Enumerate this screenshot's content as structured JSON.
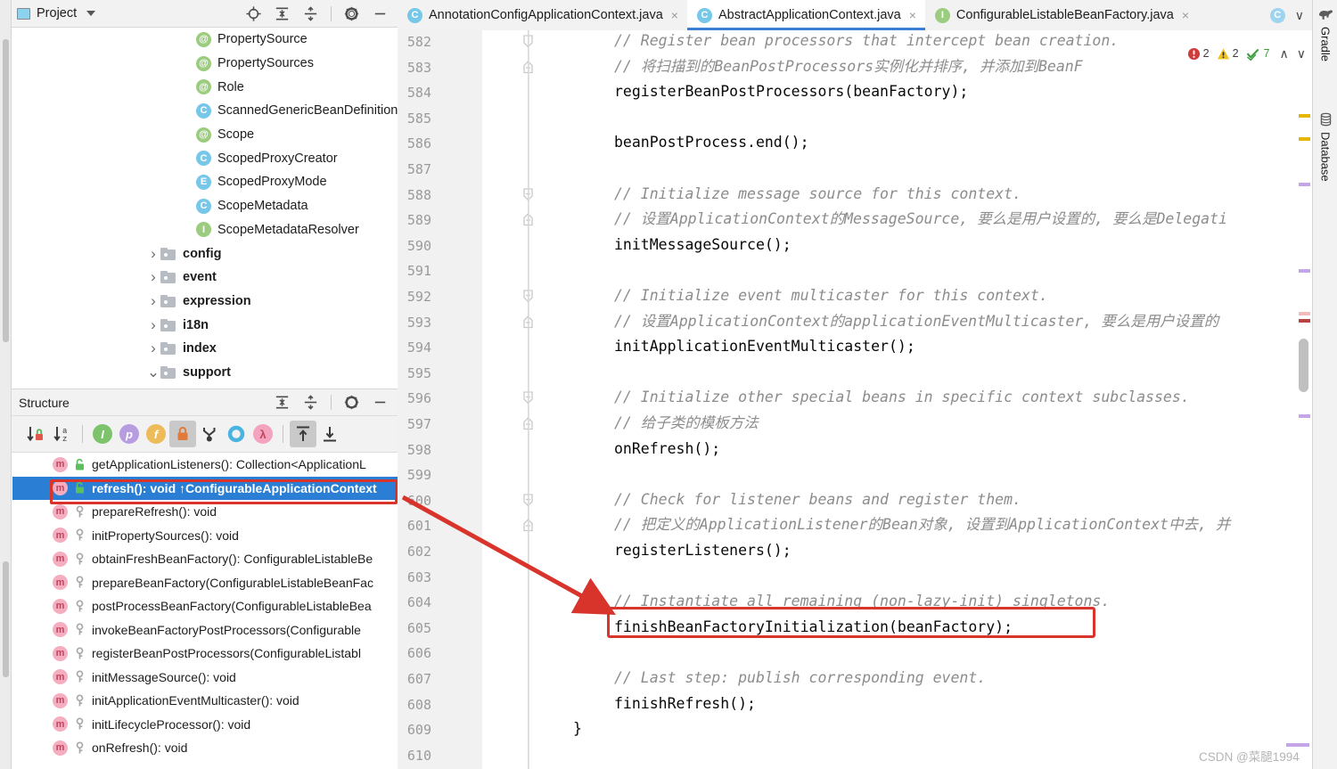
{
  "project_panel": {
    "title": "Project",
    "icon": "project-icon",
    "toolbar": [
      {
        "name": "locate-icon",
        "label": "Select Opened File"
      },
      {
        "name": "expand-all-icon",
        "label": "Expand All"
      },
      {
        "name": "collapse-all-icon",
        "label": "Collapse All"
      },
      {
        "name": "gear-icon",
        "label": "Options"
      },
      {
        "name": "minimize-icon",
        "label": "Hide"
      }
    ],
    "tree": [
      {
        "label": "PropertySource",
        "kind": "annotation",
        "badge": "@",
        "indent": 2,
        "arrow": ""
      },
      {
        "label": "PropertySources",
        "kind": "annotation",
        "badge": "@",
        "indent": 2,
        "arrow": ""
      },
      {
        "label": "Role",
        "kind": "annotation",
        "badge": "@",
        "indent": 2,
        "arrow": ""
      },
      {
        "label": "ScannedGenericBeanDefinition",
        "kind": "class",
        "badge": "C",
        "indent": 2,
        "arrow": ""
      },
      {
        "label": "Scope",
        "kind": "annotation",
        "badge": "@",
        "indent": 2,
        "arrow": ""
      },
      {
        "label": "ScopedProxyCreator",
        "kind": "class",
        "badge": "C",
        "indent": 2,
        "arrow": ""
      },
      {
        "label": "ScopedProxyMode",
        "kind": "enum",
        "badge": "E",
        "indent": 2,
        "arrow": ""
      },
      {
        "label": "ScopeMetadata",
        "kind": "class",
        "badge": "C",
        "indent": 2,
        "arrow": ""
      },
      {
        "label": "ScopeMetadataResolver",
        "kind": "interface",
        "badge": "I",
        "indent": 2,
        "arrow": ""
      },
      {
        "label": "config",
        "kind": "folder",
        "badge": "",
        "indent": 1,
        "arrow": "collapsed"
      },
      {
        "label": "event",
        "kind": "folder",
        "badge": "",
        "indent": 1,
        "arrow": "collapsed"
      },
      {
        "label": "expression",
        "kind": "folder",
        "badge": "",
        "indent": 1,
        "arrow": "collapsed"
      },
      {
        "label": "i18n",
        "kind": "folder",
        "badge": "",
        "indent": 1,
        "arrow": "collapsed"
      },
      {
        "label": "index",
        "kind": "folder",
        "badge": "",
        "indent": 1,
        "arrow": "collapsed"
      },
      {
        "label": "support",
        "kind": "folder",
        "badge": "",
        "indent": 1,
        "arrow": "expanded"
      }
    ]
  },
  "structure_panel": {
    "title": "Structure",
    "header_icons": [
      {
        "name": "expand-all-icon"
      },
      {
        "name": "collapse-all-icon"
      },
      {
        "name": "gear-icon"
      },
      {
        "name": "minimize-icon"
      }
    ],
    "toolbar": [
      {
        "name": "sort-by-visibility-icon",
        "active": false
      },
      {
        "name": "sort-alphabetically-icon",
        "active": false
      },
      {
        "name": "show-inherited-icon",
        "active": false,
        "glyph": "I",
        "color": "#7dc36b"
      },
      {
        "name": "show-properties-icon",
        "active": false,
        "glyph": "p",
        "color": "#b79cdf"
      },
      {
        "name": "show-fields-icon",
        "active": false,
        "glyph": "f",
        "color": "#eebb5a"
      },
      {
        "name": "show-non-public-icon",
        "active": true,
        "glyph": "lock",
        "color": "#e07b3c"
      },
      {
        "name": "show-anonymous-classes-icon",
        "active": false
      },
      {
        "name": "show-properties-group-icon",
        "active": false
      },
      {
        "name": "show-lambdas-icon",
        "active": false,
        "glyph": "λ",
        "color": "#f3a3bd"
      },
      {
        "name": "expand-all-icon",
        "active": true
      },
      {
        "name": "collapse-all-icon",
        "active": false
      }
    ],
    "members": [
      {
        "label": "getApplicationListeners(): Collection<ApplicationL",
        "visibility": "public",
        "selected": false
      },
      {
        "label": "refresh(): void ↑ConfigurableApplicationContext",
        "visibility": "public",
        "selected": true
      },
      {
        "label": "prepareRefresh(): void",
        "visibility": "protected",
        "selected": false
      },
      {
        "label": "initPropertySources(): void",
        "visibility": "protected",
        "selected": false
      },
      {
        "label": "obtainFreshBeanFactory(): ConfigurableListableBe",
        "visibility": "protected",
        "selected": false
      },
      {
        "label": "prepareBeanFactory(ConfigurableListableBeanFac",
        "visibility": "protected",
        "selected": false
      },
      {
        "label": "postProcessBeanFactory(ConfigurableListableBea",
        "visibility": "protected",
        "selected": false
      },
      {
        "label": "invokeBeanFactoryPostProcessors(Configurable",
        "visibility": "protected",
        "selected": false
      },
      {
        "label": "registerBeanPostProcessors(ConfigurableListabl",
        "visibility": "protected",
        "selected": false
      },
      {
        "label": "initMessageSource(): void",
        "visibility": "protected",
        "selected": false
      },
      {
        "label": "initApplicationEventMulticaster(): void",
        "visibility": "protected",
        "selected": false
      },
      {
        "label": "initLifecycleProcessor(): void",
        "visibility": "protected",
        "selected": false
      },
      {
        "label": "onRefresh(): void",
        "visibility": "protected",
        "selected": false
      }
    ]
  },
  "editor": {
    "tabs": [
      {
        "label": "AnnotationConfigApplicationContext.java",
        "badge": "C",
        "badge_color": "#76c7e8",
        "active": false,
        "closable": true
      },
      {
        "label": "AbstractApplicationContext.java",
        "badge": "C",
        "badge_color": "#76c7e8",
        "active": true,
        "closable": true
      },
      {
        "label": "ConfigurableListableBeanFactory.java",
        "badge": "I",
        "badge_color": "#9ccc7f",
        "active": false,
        "closable": true
      }
    ],
    "overflow": {
      "badge": "C",
      "chevron": "chevron-down-icon"
    },
    "first_line_number": 582,
    "lines": [
      {
        "num": 582,
        "text": "// Register bean processors that intercept bean creation.",
        "style": "comment",
        "fold": "end"
      },
      {
        "num": 583,
        "text": "// 将扫描到的BeanPostProcessors实例化并排序, 并添加到BeanF",
        "style": "comment",
        "fold": "end2"
      },
      {
        "num": 584,
        "text": "registerBeanPostProcessors(beanFactory);",
        "style": "code",
        "fold": ""
      },
      {
        "num": 585,
        "text": "",
        "style": "code",
        "fold": ""
      },
      {
        "num": 586,
        "text": "beanPostProcess.end();",
        "style": "code",
        "fold": ""
      },
      {
        "num": 587,
        "text": "",
        "style": "code",
        "fold": ""
      },
      {
        "num": 588,
        "text": "// Initialize message source for this context.",
        "style": "comment",
        "fold": "start"
      },
      {
        "num": 589,
        "text": "// 设置ApplicationContext的MessageSource, 要么是用户设置的, 要么是Delegati",
        "style": "comment",
        "fold": "end2"
      },
      {
        "num": 590,
        "text": "initMessageSource();",
        "style": "code",
        "fold": ""
      },
      {
        "num": 591,
        "text": "",
        "style": "code",
        "fold": ""
      },
      {
        "num": 592,
        "text": "// Initialize event multicaster for this context.",
        "style": "comment",
        "fold": "start"
      },
      {
        "num": 593,
        "text": "// 设置ApplicationContext的applicationEventMulticaster, 要么是用户设置的",
        "style": "comment",
        "fold": "end2"
      },
      {
        "num": 594,
        "text": "initApplicationEventMulticaster();",
        "style": "code",
        "fold": ""
      },
      {
        "num": 595,
        "text": "",
        "style": "code",
        "fold": ""
      },
      {
        "num": 596,
        "text": "// Initialize other special beans in specific context subclasses.",
        "style": "comment",
        "fold": "start"
      },
      {
        "num": 597,
        "text": "// 给子类的模板方法",
        "style": "comment",
        "fold": "end2"
      },
      {
        "num": 598,
        "text": "onRefresh();",
        "style": "code",
        "fold": ""
      },
      {
        "num": 599,
        "text": "",
        "style": "code",
        "fold": ""
      },
      {
        "num": 600,
        "text": "// Check for listener beans and register them.",
        "style": "comment",
        "fold": "start"
      },
      {
        "num": 601,
        "text": "// 把定义的ApplicationListener的Bean对象, 设置到ApplicationContext中去, 并",
        "style": "comment",
        "fold": "end2"
      },
      {
        "num": 602,
        "text": "registerListeners();",
        "style": "code",
        "fold": ""
      },
      {
        "num": 603,
        "text": "",
        "style": "code",
        "fold": ""
      },
      {
        "num": 604,
        "text": "// Instantiate all remaining (non-lazy-init) singletons.",
        "style": "comment",
        "fold": ""
      },
      {
        "num": 605,
        "text": "finishBeanFactoryInitialization(beanFactory);",
        "style": "code",
        "fold": ""
      },
      {
        "num": 606,
        "text": "",
        "style": "code",
        "fold": ""
      },
      {
        "num": 607,
        "text": "// Last step: publish corresponding event.",
        "style": "comment",
        "fold": ""
      },
      {
        "num": 608,
        "text": "finishRefresh();",
        "style": "code",
        "fold": ""
      },
      {
        "num": 609,
        "text": "}",
        "style": "brace",
        "fold": ""
      },
      {
        "num": 610,
        "text": "",
        "style": "code",
        "fold": ""
      }
    ],
    "highlighted_line": "finishBeanFactoryInitialization(beanFactory);",
    "inspections": {
      "errors": "2",
      "warnings": "2",
      "ok_count": "7",
      "error_icon": "error-icon",
      "warning_icon": "warning-icon",
      "ok_icon": "inspection-ok-icon",
      "prev_icon": "chevron-up-icon",
      "next_icon": "chevron-down-icon"
    }
  },
  "right_rail": {
    "tabs": [
      {
        "label": "Gradle",
        "icon": "gradle-elephant-icon"
      },
      {
        "label": "Database",
        "icon": "database-icon"
      }
    ]
  },
  "watermark": {
    "text": "CSDN @菜腿1994"
  },
  "colors": {
    "selection_blue": "#2a7fd4",
    "annotation_red": "#d9342b",
    "tab_underline": "#3b7fd4",
    "panel_bg": "#f2f2f2",
    "gutter_bg": "#f1f1f1"
  }
}
